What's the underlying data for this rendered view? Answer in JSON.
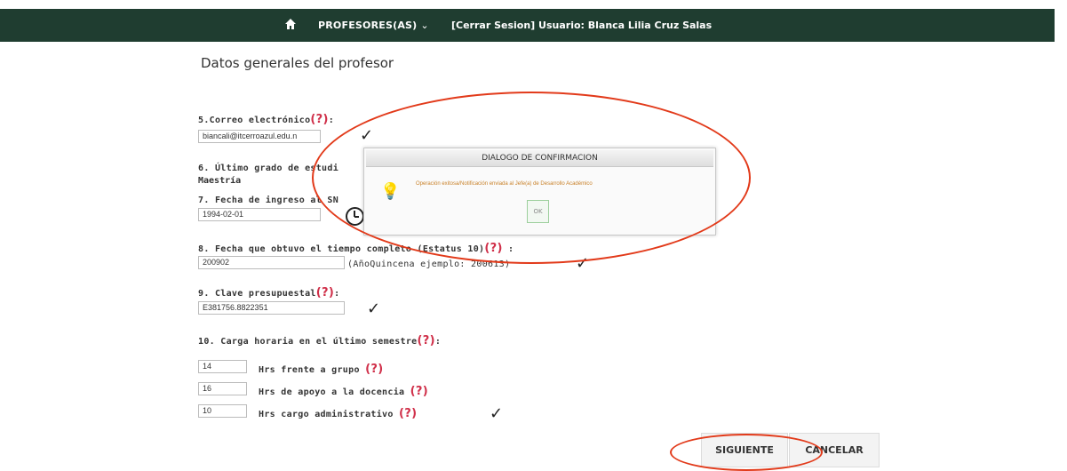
{
  "header": {
    "menu_label": "PROFESORES(AS)",
    "session_text": "[Cerrar Sesion] Usuario: Blanca Lilia Cruz Salas"
  },
  "page_title": "Datos generales del profesor",
  "fields": {
    "email": {
      "label": "5.Correo electrónico",
      "help": "(?)",
      "value": "biancali@itcerroazul.edu.n"
    },
    "grado": {
      "label": "6. Último grado de estudi",
      "value": "Maestría"
    },
    "fecha_ingreso": {
      "label": "7. Fecha de ingreso al SN",
      "value": "1994-02-01"
    },
    "fecha_tiempo": {
      "label": "8. Fecha que obtuvo el tiempo completo (Estatus 10)",
      "help": "(?)",
      "value": "200902",
      "hint": "(AñoQuincena ejemplo: 200613)"
    },
    "clave": {
      "label": "9. Clave presupuestal",
      "help": "(?)",
      "value": "E381756.8822351"
    },
    "carga": {
      "label": "10. Carga horaria en el último semestre",
      "help": "(?)",
      "rows": [
        {
          "value": "14",
          "label": "Hrs frente a grupo",
          "help": "(?)"
        },
        {
          "value": "16",
          "label": "Hrs de apoyo a la docencia",
          "help": "(?)"
        },
        {
          "value": "10",
          "label": "Hrs cargo administrativo",
          "help": "(?)"
        }
      ]
    }
  },
  "dialog": {
    "title": "DIALOGO DE CONFIRMACION",
    "message": "Operación exitosa/Notificación enviada al Jefe(a) de Desarrollo Académico",
    "ok_label": "OK"
  },
  "buttons": {
    "next": "SIGUIENTE",
    "cancel": "CANCELAR"
  },
  "colors": {
    "header_bg": "#1f3d30",
    "help_red": "#d0304a",
    "annotation_red": "#e23a1a"
  }
}
